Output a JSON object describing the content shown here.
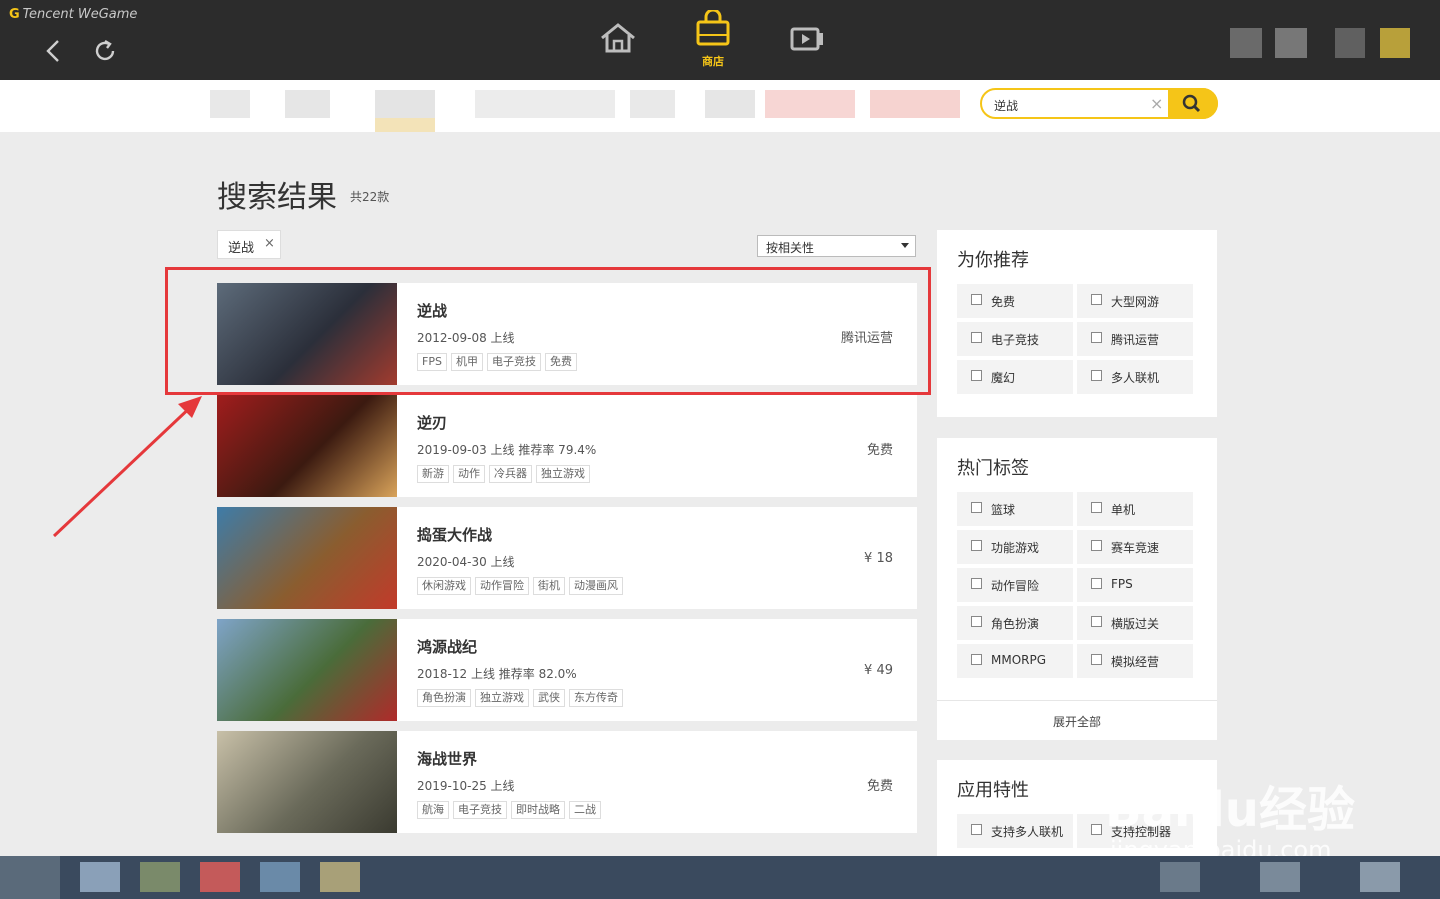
{
  "app": {
    "brand": "Tencent WeGame",
    "brand_mark": "G"
  },
  "nav": {
    "shop_label": "商店"
  },
  "search": {
    "value": "逆战",
    "clear_glyph": "×"
  },
  "results": {
    "title": "搜索结果",
    "count": "共22款",
    "filter_chip": "逆战",
    "chip_close": "×",
    "sort_label": "按相关性"
  },
  "games": [
    {
      "name": "逆战",
      "meta": "2012-09-08 上线",
      "price": "腾讯运营",
      "tags": [
        "FPS",
        "机甲",
        "电子竞技",
        "免费"
      ],
      "thumb_colors": [
        "#5d6b7a",
        "#2b2f3a",
        "#a23b2e"
      ]
    },
    {
      "name": "逆刃",
      "meta": "2019-09-03 上线 推荐率 79.4%",
      "price": "免费",
      "tags": [
        "新游",
        "动作",
        "冷兵器",
        "独立游戏"
      ],
      "thumb_colors": [
        "#a11d1d",
        "#3b1a10",
        "#d9a35a"
      ]
    },
    {
      "name": "捣蛋大作战",
      "meta": "2020-04-30 上线",
      "price": "¥ 18",
      "tags": [
        "休闲游戏",
        "动作冒险",
        "街机",
        "动漫画风"
      ],
      "thumb_colors": [
        "#3e7ca8",
        "#8a5d2f",
        "#c23a2a"
      ]
    },
    {
      "name": "鸿源战纪",
      "meta": "2018-12 上线 推荐率 82.0%",
      "price": "¥ 49",
      "tags": [
        "角色扮演",
        "独立游戏",
        "武侠",
        "东方传奇"
      ],
      "thumb_colors": [
        "#7fa4c8",
        "#4a6c3a",
        "#b02a2a"
      ]
    },
    {
      "name": "海战世界",
      "meta": "2019-10-25 上线",
      "price": "免费",
      "tags": [
        "航海",
        "电子竞技",
        "即时战略",
        "二战"
      ],
      "thumb_colors": [
        "#c8c0a8",
        "#6a6a5a",
        "#3a3a30"
      ]
    }
  ],
  "panels": {
    "recommend": {
      "title": "为你推荐",
      "options": [
        "免费",
        "大型网游",
        "电子竞技",
        "腾讯运营",
        "魔幻",
        "多人联机"
      ]
    },
    "hot_tags": {
      "title": "热门标签",
      "options": [
        "篮球",
        "单机",
        "功能游戏",
        "赛车竞速",
        "动作冒险",
        "FPS",
        "角色扮演",
        "横版过关",
        "MMORPG",
        "模拟经营"
      ],
      "expand_label": "展开全部"
    },
    "features": {
      "title": "应用特性",
      "options": [
        "支持多人联机",
        "支持控制器"
      ]
    }
  },
  "watermark": {
    "text": "Baidu经验",
    "sub": "jingyan.baidu.com"
  },
  "colors": {
    "accent": "#f5c518",
    "highlight": "#e5383b",
    "topbar": "#2c2c2c"
  }
}
